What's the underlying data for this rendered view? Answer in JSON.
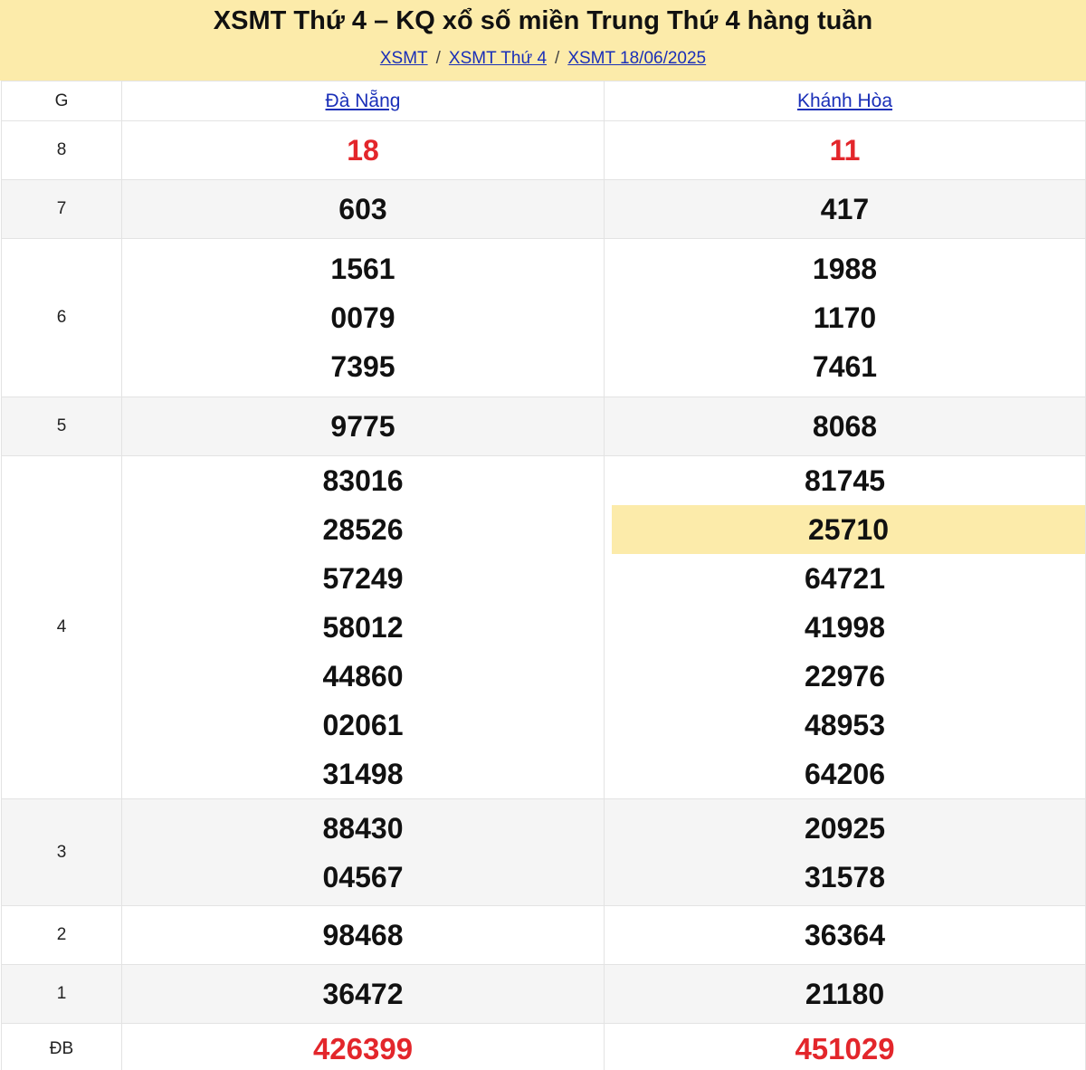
{
  "header": {
    "title": "XSMT Thứ 4 – KQ xổ số miền Trung Thứ 4 hàng tuần",
    "breadcrumb": [
      "XSMT",
      "XSMT Thứ 4",
      "XSMT 18/06/2025"
    ],
    "breadcrumb_separator": "/"
  },
  "table": {
    "col_label": "G",
    "provinces": [
      "Đà Nẵng",
      "Khánh Hòa"
    ],
    "prizes": [
      {
        "label": "8",
        "a": [
          "18"
        ],
        "b": [
          "11"
        ]
      },
      {
        "label": "7",
        "a": [
          "603"
        ],
        "b": [
          "417"
        ]
      },
      {
        "label": "6",
        "a": [
          "1561",
          "0079",
          "7395"
        ],
        "b": [
          "1988",
          "1170",
          "7461"
        ]
      },
      {
        "label": "5",
        "a": [
          "9775"
        ],
        "b": [
          "8068"
        ]
      },
      {
        "label": "4",
        "a": [
          "83016",
          "28526",
          "57249",
          "58012",
          "44860",
          "02061",
          "31498"
        ],
        "b": [
          "81745",
          "25710",
          "64721",
          "41998",
          "22976",
          "48953",
          "64206"
        ]
      },
      {
        "label": "3",
        "a": [
          "88430",
          "04567"
        ],
        "b": [
          "20925",
          "31578"
        ]
      },
      {
        "label": "2",
        "a": [
          "98468"
        ],
        "b": [
          "36364"
        ]
      },
      {
        "label": "1",
        "a": [
          "36472"
        ],
        "b": [
          "21180"
        ]
      },
      {
        "label": "ĐB",
        "a": [
          "426399"
        ],
        "b": [
          "451029"
        ]
      }
    ]
  },
  "colors": {
    "header_bg": "#fcebaa",
    "link": "#1a2fb8",
    "special_red": "#e3262b",
    "highlight": "#fcebaa"
  }
}
